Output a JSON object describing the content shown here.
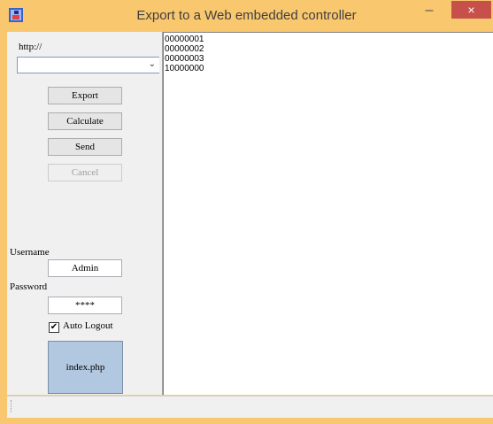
{
  "window": {
    "title": "Export to a Web embedded controller",
    "minimize_label": "–",
    "close_label": "×"
  },
  "colors": {
    "titlebar": "#f9c76e",
    "close": "#c7504b",
    "tile": "#b2c7e0"
  },
  "form": {
    "url_label": "http://",
    "url_value": "",
    "buttons": {
      "export": "Export",
      "calculate": "Calculate",
      "send": "Send",
      "cancel": "Cancel"
    },
    "username_label": "Username",
    "username_value": "Admin",
    "password_label": "Password",
    "password_value": "****",
    "auto_logout_label": "Auto Logout",
    "auto_logout_checked": true,
    "tile_label": "index.php"
  },
  "output": {
    "lines": [
      "00000001",
      "00000002",
      "00000003",
      "10000000"
    ]
  },
  "icons": {
    "app": "app-icon",
    "combo_arrow": "chevron-down-icon",
    "status_grip": "grip-icon"
  }
}
